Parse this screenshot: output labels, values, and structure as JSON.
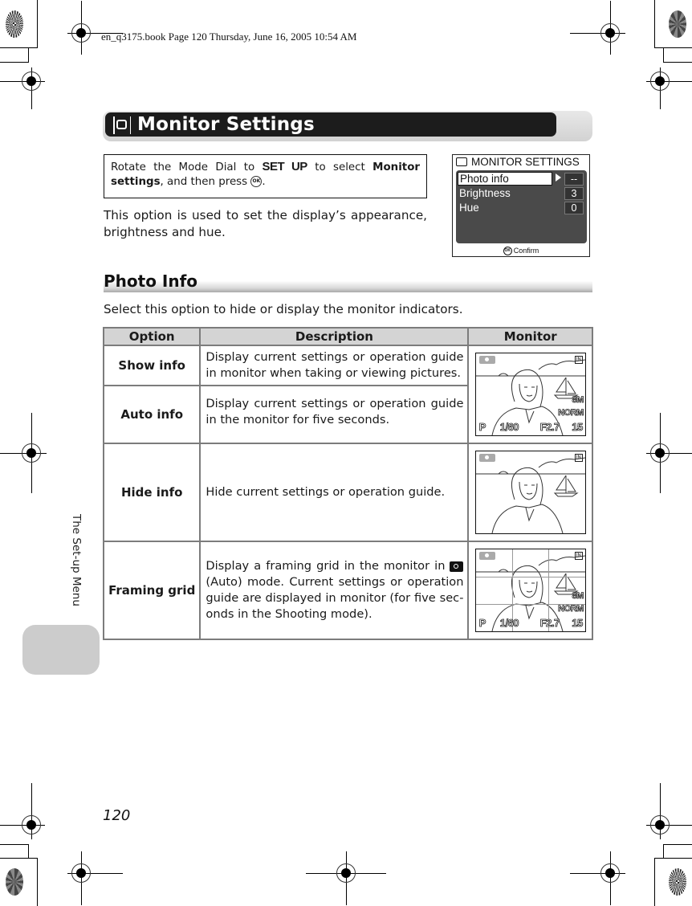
{
  "print_slug": "en_q3175.book  Page 120  Thursday, June 16, 2005  10:54 AM",
  "header": {
    "icon": "monitor-icon",
    "title": "Monitor Settings"
  },
  "instruction": {
    "part1": "Rotate the Mode Dial to ",
    "mode": "SET UP",
    "part2": " to select ",
    "menu_name_1": "Monitor",
    "menu_name_2": "settings",
    "part3": ", and then press ",
    "button": "OK",
    "part4": "."
  },
  "intro": "This option is used to set the display’s appearance, brightness and hue.",
  "camera_menu": {
    "icon": "monitor-icon",
    "title": "MONITOR SETTINGS",
    "items": [
      {
        "label": "Photo info",
        "value": "--",
        "selected": true
      },
      {
        "label": "Brightness",
        "value": "3",
        "selected": false
      },
      {
        "label": "Hue",
        "value": "0",
        "selected": false
      }
    ],
    "footer_button": "OK",
    "footer_label": "Confirm"
  },
  "section": {
    "title": "Photo Info",
    "intro": "Select this option to hide or display the monitor indicators."
  },
  "table": {
    "headers": [
      "Option",
      "Description",
      "Monitor"
    ],
    "rows": [
      {
        "option": "Show info",
        "description": "Display current settings or operation guide in monitor when taking or viewing pictures."
      },
      {
        "option": "Auto info",
        "description": "Display current settings or operation guide in the monitor for five seconds."
      },
      {
        "option": "Hide info",
        "description": "Hide current settings or operation guide."
      },
      {
        "option": "Framing grid",
        "description_pre": "Display a framing grid in the monitor in ",
        "description_icon": "auto-mode-camera-icon",
        "description_post": " (Auto) mode. Current settings or operation guide are displayed in monitor (for five sec-onds in the Shooting mode)."
      }
    ],
    "osd": {
      "mode": "P",
      "shutter": "1/60",
      "aperture": "F2.7",
      "frames": "15",
      "image_size": "8M",
      "quality": "NORM",
      "memory": "IN"
    }
  },
  "side_tab_label": "The Set-up Menu",
  "page_number": "120"
}
